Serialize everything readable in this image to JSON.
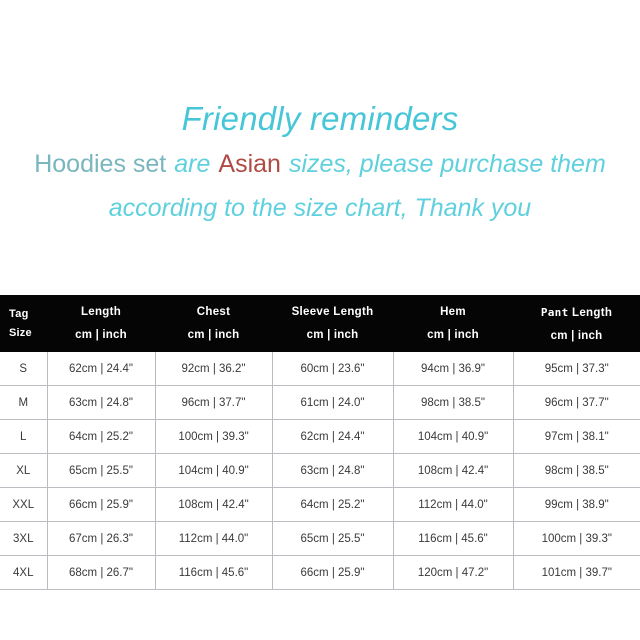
{
  "reminder": {
    "title": "Friendly reminders",
    "line2_lead": "Hoodies set",
    "line2_are": "are",
    "line2_accent": "Asian",
    "line2_rest": "sizes, please purchase them",
    "line3": "according to the size chart, Thank you"
  },
  "colors": {
    "title_cyan": "#47c6d8",
    "body_cyan": "#5fd0dd",
    "lead_teal": "#79b6be",
    "accent_red": "#b04a45",
    "header_black": "#050505",
    "grid_gray": "#b9bcc0",
    "cell_text": "#3a3a3a"
  },
  "table": {
    "headers": [
      {
        "name_line1": "Tag",
        "name_line2": "Size",
        "unit": ""
      },
      {
        "name": "Length",
        "unit": "cm | inch"
      },
      {
        "name": "Chest",
        "unit": "cm | inch"
      },
      {
        "name": "Sleeve Length",
        "unit": "cm | inch"
      },
      {
        "name": "Hem",
        "unit": "cm | inch"
      },
      {
        "name_mono": "Pant",
        "name_rest": "Length",
        "unit": "cm | inch"
      }
    ],
    "rows": [
      {
        "tag": "S",
        "length": "62cm | 24.4\"",
        "chest": "92cm | 36.2\"",
        "sleeve": "60cm | 23.6\"",
        "hem": "94cm | 36.9\"",
        "pant": "95cm | 37.3\""
      },
      {
        "tag": "M",
        "length": "63cm | 24.8\"",
        "chest": "96cm | 37.7\"",
        "sleeve": "61cm | 24.0\"",
        "hem": "98cm | 38.5\"",
        "pant": "96cm | 37.7\""
      },
      {
        "tag": "L",
        "length": "64cm | 25.2\"",
        "chest": "100cm | 39.3\"",
        "sleeve": "62cm | 24.4\"",
        "hem": "104cm | 40.9\"",
        "pant": "97cm | 38.1\""
      },
      {
        "tag": "XL",
        "length": "65cm | 25.5\"",
        "chest": "104cm | 40.9\"",
        "sleeve": "63cm | 24.8\"",
        "hem": "108cm | 42.4\"",
        "pant": "98cm | 38.5\""
      },
      {
        "tag": "XXL",
        "length": "66cm | 25.9\"",
        "chest": "108cm | 42.4\"",
        "sleeve": "64cm | 25.2\"",
        "hem": "112cm | 44.0\"",
        "pant": "99cm | 38.9\""
      },
      {
        "tag": "3XL",
        "length": "67cm | 26.3\"",
        "chest": "112cm | 44.0\"",
        "sleeve": "65cm | 25.5\"",
        "hem": "116cm | 45.6\"",
        "pant": "100cm | 39.3\""
      },
      {
        "tag": "4XL",
        "length": "68cm | 26.7\"",
        "chest": "116cm | 45.6\"",
        "sleeve": "66cm | 25.9\"",
        "hem": "120cm | 47.2\"",
        "pant": "101cm | 39.7\""
      }
    ]
  }
}
